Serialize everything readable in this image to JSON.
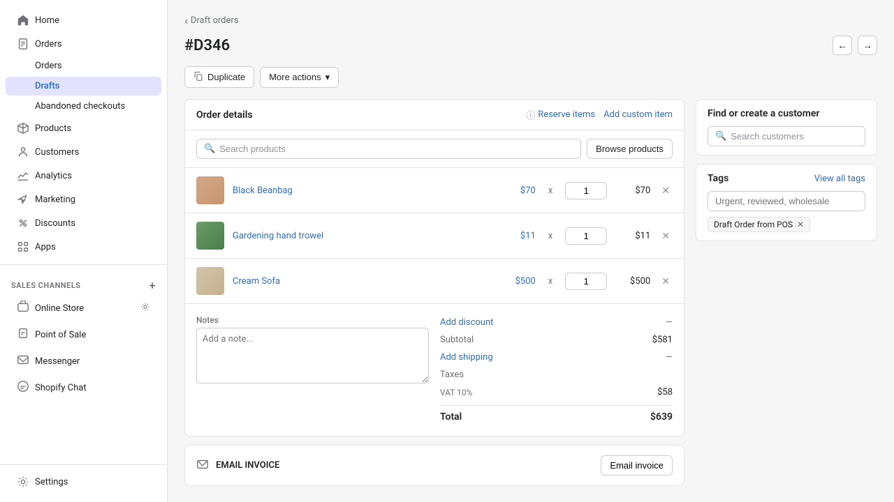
{
  "sidebar": {
    "items": [
      {
        "id": "home",
        "label": "Home",
        "icon": "home"
      },
      {
        "id": "orders",
        "label": "Orders",
        "icon": "orders",
        "children": [
          {
            "id": "orders-list",
            "label": "Orders"
          },
          {
            "id": "drafts",
            "label": "Drafts",
            "active": true
          },
          {
            "id": "abandoned",
            "label": "Abandoned checkouts"
          }
        ]
      },
      {
        "id": "products",
        "label": "Products",
        "icon": "products"
      },
      {
        "id": "customers",
        "label": "Customers",
        "icon": "customers"
      },
      {
        "id": "analytics",
        "label": "Analytics",
        "icon": "analytics"
      },
      {
        "id": "marketing",
        "label": "Marketing",
        "icon": "marketing"
      },
      {
        "id": "discounts",
        "label": "Discounts",
        "icon": "discounts"
      },
      {
        "id": "apps",
        "label": "Apps",
        "icon": "apps"
      }
    ],
    "sales_channels_title": "SALES CHANNELS",
    "channels": [
      {
        "id": "online-store",
        "label": "Online Store",
        "icon": "store"
      },
      {
        "id": "point-of-sale",
        "label": "Point of Sale",
        "icon": "pos"
      },
      {
        "id": "messenger",
        "label": "Messenger",
        "icon": "messenger"
      },
      {
        "id": "shopify-chat",
        "label": "Shopify Chat",
        "icon": "chat"
      }
    ],
    "settings_label": "Settings"
  },
  "breadcrumb": {
    "text": "Draft orders",
    "chevron": "‹"
  },
  "header": {
    "title": "#D346",
    "nav_prev": "←",
    "nav_next": "→"
  },
  "toolbar": {
    "duplicate_label": "Duplicate",
    "more_actions_label": "More actions",
    "dropdown_icon": "▾"
  },
  "order_details": {
    "title": "Order details",
    "reserve_items_label": "Reserve items",
    "add_custom_item_label": "Add custom item",
    "search_placeholder": "Search products",
    "browse_products_label": "Browse products",
    "products": [
      {
        "id": "black-beanbag",
        "name": "Black Beanbag",
        "price": "$70",
        "qty": "1",
        "total": "$70",
        "thumb_type": "brown"
      },
      {
        "id": "gardening-hand-trowel",
        "name": "Gardening hand trowel",
        "price": "$11",
        "qty": "1",
        "total": "$11",
        "thumb_type": "green"
      },
      {
        "id": "cream-sofa",
        "name": "Cream Sofa",
        "price": "$500",
        "qty": "1",
        "total": "$500",
        "thumb_type": "cream"
      }
    ],
    "notes_placeholder": "Add a note...",
    "notes_label": "Notes",
    "add_discount_label": "Add discount",
    "subtotal_label": "Subtotal",
    "subtotal_value": "$581",
    "add_shipping_label": "Add shipping",
    "shipping_dash": "—",
    "discount_dash": "—",
    "taxes_label": "Taxes",
    "tax_detail": "VAT 10%",
    "tax_value": "$58",
    "total_label": "Total",
    "total_value": "$639"
  },
  "email_invoice": {
    "section_label": "EMAIL INVOICE",
    "button_label": "Email invoice"
  },
  "find_customer": {
    "title": "Find or create a customer",
    "search_placeholder": "Search customers"
  },
  "tags": {
    "title": "Tags",
    "view_all_label": "View all tags",
    "input_placeholder": "Urgent, reviewed, wholesale",
    "chips": [
      {
        "id": "draft-order-pos",
        "label": "Draft Order from POS"
      }
    ]
  }
}
